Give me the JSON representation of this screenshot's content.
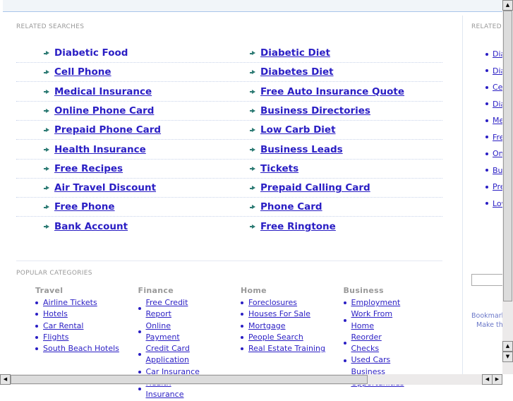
{
  "related_searches": {
    "title": "RELATED SEARCHES",
    "left": [
      "Diabetic Food",
      "Cell Phone",
      "Medical Insurance",
      "Online Phone Card",
      "Prepaid Phone Card",
      "Health Insurance",
      "Free Recipes",
      "Air Travel Discount",
      "Free Phone",
      "Bank Account"
    ],
    "right": [
      "Diabetic Diet",
      "Diabetes Diet",
      "Free Auto Insurance Quote",
      "Business Directories",
      "Low Carb Diet",
      "Business Leads",
      "Tickets",
      "Prepaid Calling Card",
      "Phone Card",
      "Free Ringtone"
    ]
  },
  "popular_categories": {
    "title": "POPULAR CATEGORIES",
    "columns": [
      {
        "heading": "Travel",
        "items": [
          "Airline Tickets",
          "Hotels",
          "Car Rental",
          "Flights",
          "South Beach Hotels"
        ]
      },
      {
        "heading": "Finance",
        "items": [
          "Free Credit Report",
          "Online Payment",
          "Credit Card Application",
          "Car Insurance",
          "Health Insurance"
        ]
      },
      {
        "heading": "Home",
        "items": [
          "Foreclosures",
          "Houses For Sale",
          "Mortgage",
          "People Search",
          "Real Estate Training"
        ]
      },
      {
        "heading": "Business",
        "items": [
          "Employment",
          "Work From Home",
          "Reorder Checks",
          "Used Cars",
          "Business Opportunities"
        ]
      }
    ]
  },
  "sidebar": {
    "title": "RELATED",
    "items": [
      "Diabetic Food",
      "Diabetic Diet",
      "Cell Phone",
      "Diabetes Diet",
      "Medical Insurance",
      "Free Auto Insurance Quote",
      "Online Phone Card",
      "Business Directories",
      "Prepaid Phone Card",
      "Low Carb Diet"
    ],
    "search_value": "",
    "bookmark": "Bookmark",
    "make_home": "Make thi"
  }
}
